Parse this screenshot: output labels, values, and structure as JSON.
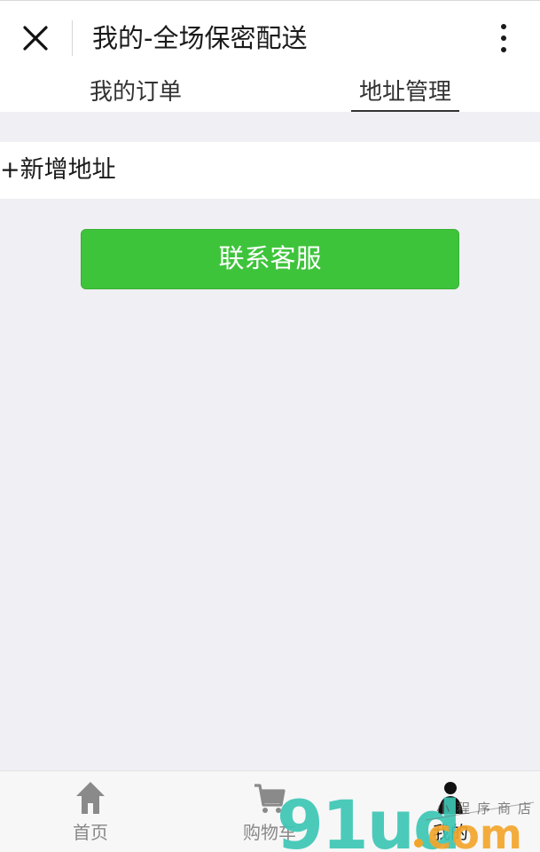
{
  "header": {
    "title": "我的-全场保密配送"
  },
  "tabs": [
    {
      "label": "我的订单",
      "active": false
    },
    {
      "label": "地址管理",
      "active": true
    }
  ],
  "address": {
    "add_label": "+新增地址"
  },
  "contact": {
    "label": "联系客服"
  },
  "tabbar": {
    "items": [
      {
        "label": "首页",
        "icon": "home-icon"
      },
      {
        "label": "购物车",
        "icon": "cart-icon"
      },
      {
        "label": "我的",
        "icon": "user-icon"
      }
    ]
  },
  "watermark": {
    "text": "91ud.com",
    "subtext": "小程序商店"
  },
  "colors": {
    "accent_green": "#3ec43b",
    "background": "#efeff4",
    "watermark_teal": "#3cc6b4",
    "watermark_orange": "#f2a52b"
  }
}
